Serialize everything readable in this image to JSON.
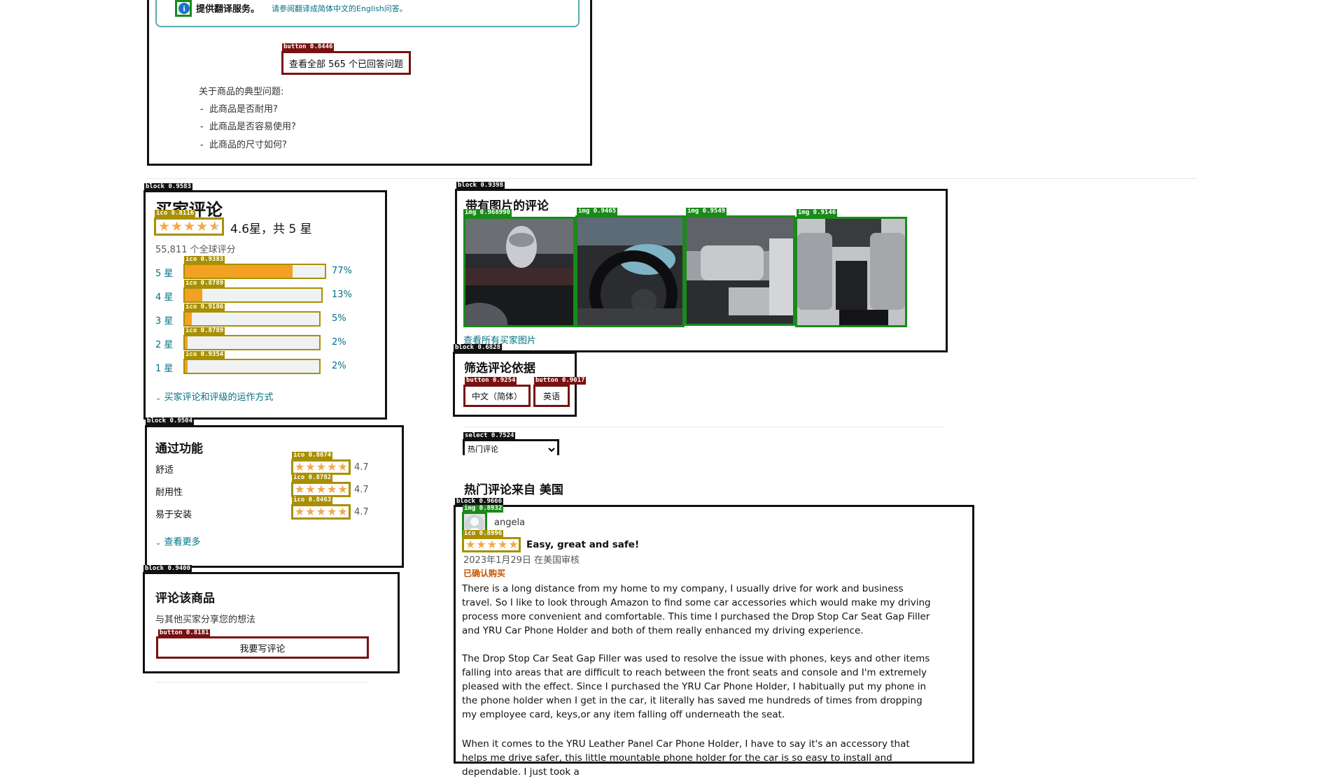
{
  "qa": {
    "banner_title": "提供翻译服务。",
    "banner_note": "请参阅翻译成简体中文的English问答。",
    "see_all_button": "查看全部 565 个已回答问题",
    "typical_heading": "关于商品的典型问题:",
    "typical_questions": [
      "此商品是否耐用?",
      "此商品是否容易使用?",
      "此商品的尺寸如何?"
    ]
  },
  "ratings": {
    "title": "买家评论",
    "average": "4.6星，共 5 星",
    "total": "55,811 个全球评分",
    "rows": [
      {
        "label": "5 星",
        "percent_text": "77%",
        "percent": 77
      },
      {
        "label": "4 星",
        "percent_text": "13%",
        "percent": 13
      },
      {
        "label": "3 星",
        "percent_text": "5%",
        "percent": 5
      },
      {
        "label": "2 星",
        "percent_text": "2%",
        "percent": 2
      },
      {
        "label": "1 星",
        "percent_text": "2%",
        "percent": 2
      }
    ],
    "how_it_works": "买家评论和评级的运作方式"
  },
  "features": {
    "title": "通过功能",
    "items": [
      {
        "name": "舒适",
        "score": "4.7"
      },
      {
        "name": "耐用性",
        "score": "4.7"
      },
      {
        "name": "易于安装",
        "score": "4.7"
      }
    ],
    "see_more": "查看更多"
  },
  "write_review": {
    "title": "评论该商品",
    "subtitle": "与其他买家分享您的想法",
    "button": "我要写评论"
  },
  "photo_reviews": {
    "title": "带有图片的评论",
    "see_all": "查看所有买家图片"
  },
  "filter": {
    "title": "筛选评论依据",
    "buttons": [
      "中文（简体）",
      "英语"
    ],
    "sort_selected": "热门评论"
  },
  "top_reviews_title": "热门评论来自 美国",
  "review": {
    "author": "angela",
    "headline": "Easy, great and safe!",
    "date": "2023年1月29日 在美国审核",
    "verified": "已确认购买",
    "paragraphs": [
      "There is a long distance from my home to my company, I usually drive for work and business travel. So I like to look through Amazon to find some car accessories which would make my driving process more convenient and comfortable. This time I purchased the Drop Stop Car Seat Gap Filler and YRU Car Phone Holder and both of them really enhanced my driving experience.",
      "The Drop Stop Car Seat Gap Filler was used to resolve the issue with phones, keys and other items falling into areas that are difficult to reach between the front seats and console and I'm extremely pleased with the effect.  Since I purchased the YRU Car Phone Holder, I habitually put my phone in the phone holder when I get in the car, it literally has saved me hundreds of times from dropping my employee card, keys,or any item falling off underneath the seat.",
      "When it comes to the YRU Leather Panel Car Phone Holder, I have to say it's an accessory that helps me drive safer, this little mountable phone holder for the car is so easy to install and dependable. I just took a"
    ]
  },
  "detections": {
    "qa_button": "button 0.8446",
    "ratings_block": "block 0.9583",
    "ratings_stars": "ico 0.8116",
    "bars": [
      "ico 0.9383",
      "ico 0.8789",
      "ico 0.9186",
      "ico 0.8789",
      "ico 0.9354"
    ],
    "features_block": "block 0.9504",
    "feature_stars": [
      "ico 0.8874",
      "ico 0.8782",
      "ico 0.8463"
    ],
    "write_block": "block 0.9400",
    "write_button": "button 0.8181",
    "photos_block": "block 0.9398",
    "photos": [
      "img 0.968990",
      "img 0.9465",
      "img 0.9549",
      "img 0.9146"
    ],
    "filter_block": "block 0.6828",
    "filter_buttons": [
      "button 0.9254",
      "button 0.9017"
    ],
    "select": "select 0.7524",
    "review_block": "block 0.9666",
    "avatar": "img 0.8932",
    "review_stars": "ico 0.8996"
  }
}
